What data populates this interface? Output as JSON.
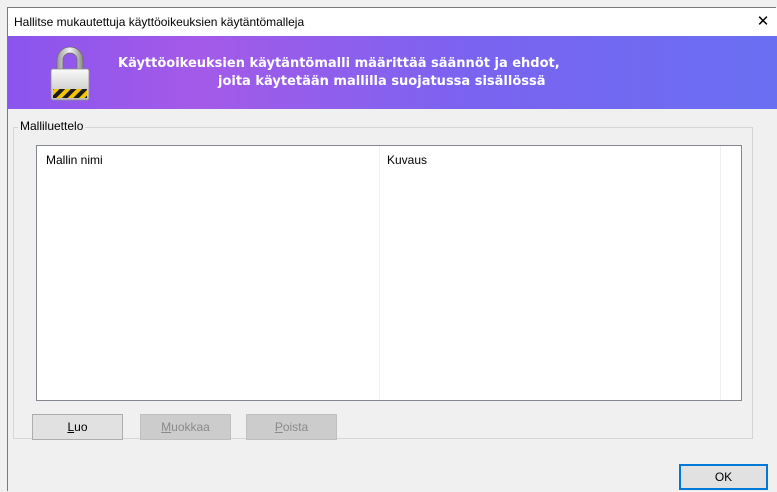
{
  "window": {
    "title": "Hallitse mukautettuja käyttöoikeuksien käytäntömalleja",
    "close_glyph": "✕"
  },
  "banner": {
    "line1": "Käyttöoikeuksien käytäntömalli määrittää säännöt ja ehdot,",
    "line2": "joita käytetään mallilla suojatussa sisällössä",
    "icon": "lock-icon"
  },
  "group": {
    "label": "Malliluettelo",
    "columns": [
      "Mallin nimi",
      "Kuvaus"
    ],
    "rows": []
  },
  "buttons": {
    "create": {
      "mnemonic": "L",
      "rest": "uo",
      "enabled": true
    },
    "edit": {
      "mnemonic": "M",
      "rest": "uokkaa",
      "enabled": false
    },
    "delete": {
      "mnemonic": "P",
      "rest": "oista",
      "enabled": false
    },
    "ok": "OK"
  },
  "colors": {
    "banner_start": "#8a55ee",
    "banner_end": "#6a6ff2",
    "ok_border": "#0078d7"
  }
}
